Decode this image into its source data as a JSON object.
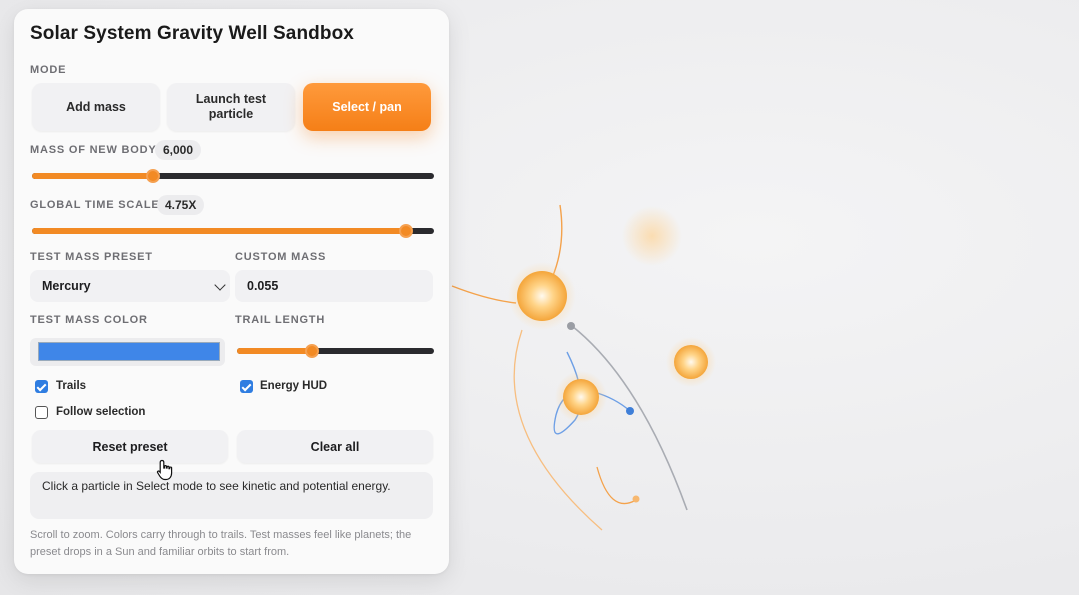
{
  "panel": {
    "title": "Solar System Gravity Well Sandbox",
    "mode_label": "MODE",
    "modes": [
      {
        "label": "Add mass",
        "active": false
      },
      {
        "label": "Launch test particle",
        "active": false
      },
      {
        "label": "Select / pan",
        "active": true
      }
    ],
    "mass_new_body": {
      "label": "MASS OF NEW BODY",
      "value": "6,000",
      "fraction": 0.3
    },
    "time_scale": {
      "label": "GLOBAL TIME SCALE",
      "value": "4.75X",
      "fraction": 0.93
    },
    "test_mass_preset": {
      "label": "TEST MASS PRESET",
      "value": "Mercury"
    },
    "custom_mass": {
      "label": "CUSTOM MASS",
      "value": "0.055"
    },
    "test_mass_color": {
      "label": "TEST MASS COLOR",
      "color": "#3f86e8"
    },
    "trail_length": {
      "label": "TRAIL LENGTH",
      "fraction": 0.38
    },
    "checks": {
      "trails": {
        "label": "Trails",
        "checked": true
      },
      "energy_hud": {
        "label": "Energy HUD",
        "checked": true
      },
      "follow_selection": {
        "label": "Follow selection",
        "checked": false
      }
    },
    "buttons": {
      "reset": "Reset preset",
      "clear": "Clear all"
    },
    "info": "Click a particle in Select mode to see kinetic and potential energy.",
    "hint": "Scroll to zoom. Colors carry through to trails. Test masses feel like planets; the preset drops in a Sun and familiar orbits to start from."
  },
  "colors": {
    "accent": "#f28a24",
    "test_mass": "#3f86e8",
    "trail_gray": "#a9acb3"
  }
}
